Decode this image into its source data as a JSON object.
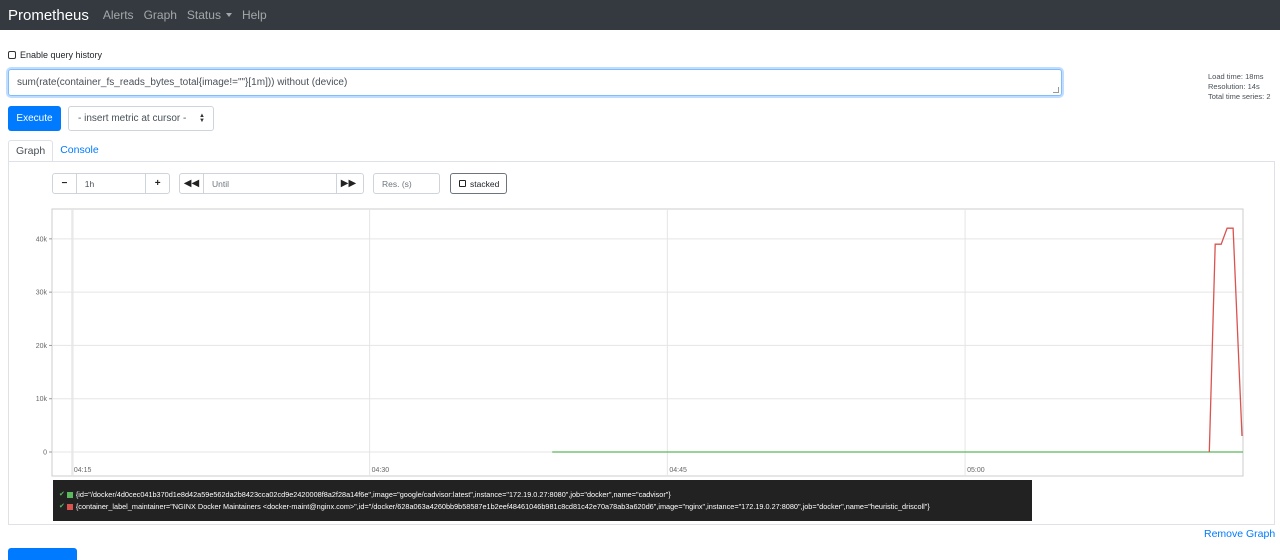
{
  "navbar": {
    "brand": "Prometheus",
    "items": [
      "Alerts",
      "Graph",
      "Status",
      "Help"
    ]
  },
  "query_history": {
    "label": "Enable query history",
    "checked": false
  },
  "expression": {
    "value": "sum(rate(container_fs_reads_bytes_total{image!=\"\"}[1m])) without (device)"
  },
  "stats": {
    "load_time": "Load time: 18ms",
    "resolution": "Resolution: 14s",
    "total_series": "Total time series: 2"
  },
  "execute_label": "Execute",
  "metric_select": {
    "selected": "- insert metric at cursor -"
  },
  "tabs": [
    {
      "label": "Graph",
      "active": true
    },
    {
      "label": "Console",
      "active": false
    }
  ],
  "controls": {
    "range": "1h",
    "until_placeholder": "Until",
    "resolution_placeholder": "Res. (s)",
    "stacked_label": "stacked"
  },
  "colors": {
    "accent": "#007bff",
    "navbar": "#343a40",
    "series1": "#5cb85c",
    "series2": "#d9534f"
  },
  "chart_data": {
    "type": "line",
    "y_ticks": [
      "40k",
      "30k",
      "20k",
      "10k",
      "0"
    ],
    "y_tick_values": [
      40000,
      30000,
      20000,
      10000,
      0
    ],
    "x_ticks": [
      "04:15",
      "04:30",
      "04:45",
      "05:00"
    ],
    "x_tick_minutes": [
      15,
      30,
      45,
      60
    ],
    "xlim_minutes": [
      14,
      74
    ],
    "ylim": [
      -4500,
      45600
    ],
    "grid": true,
    "series": [
      {
        "name": "{id=\"/docker/4d0cec041b370d1e8d42a59e562da2b8423cca02cd9e2420008f8a2f28a14f6e\",image=\"google/cadvisor:latest\",instance=\"172.19.0.27:8080\",job=\"docker\",name=\"cadvisor\"}",
        "color": "#5cb85c",
        "points": [
          [
            39.2,
            0
          ],
          [
            74,
            0
          ]
        ]
      },
      {
        "name": "{container_label_maintainer=\"NGINX Docker Maintainers <docker-maint@nginx.com>\",id=\"/docker/628a063a4260bb9b58587e1b2eef48461046b981c8cd81c42e70a78ab3a620d6\",image=\"nginx\",instance=\"172.19.0.27:8080\",job=\"docker\",name=\"heuristic_driscoll\"}",
        "color": "#d9534f",
        "points": [
          [
            72.3,
            0
          ],
          [
            72.6,
            39000
          ],
          [
            72.9,
            39000
          ],
          [
            73.2,
            42000
          ],
          [
            73.5,
            42000
          ],
          [
            73.95,
            3000
          ]
        ]
      }
    ]
  },
  "remove_graph": "Remove Graph"
}
